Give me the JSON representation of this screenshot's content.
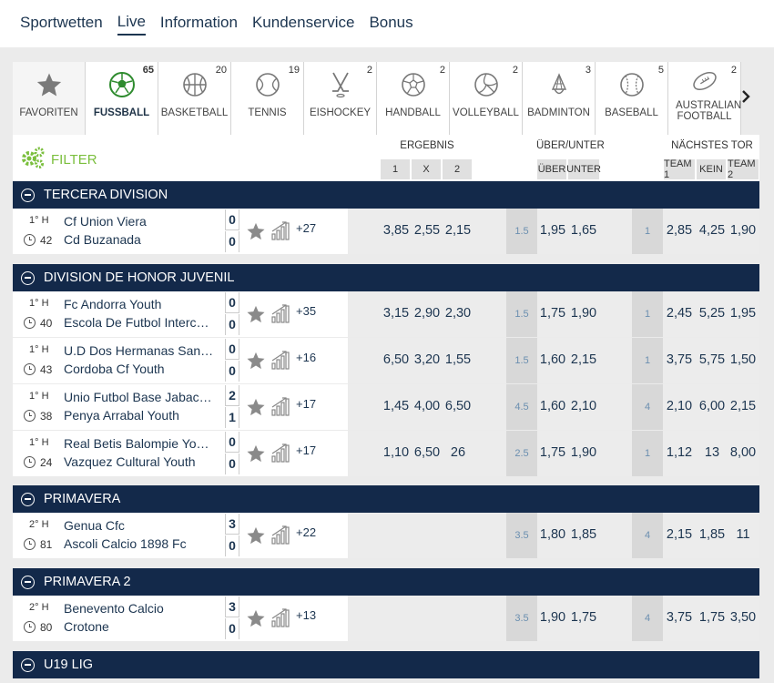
{
  "nav": {
    "items": [
      {
        "label": "Sportwetten",
        "active": false
      },
      {
        "label": "Live",
        "active": true
      },
      {
        "label": "Information",
        "active": false
      },
      {
        "label": "Kundenservice",
        "active": false
      },
      {
        "label": "Bonus",
        "active": false
      }
    ]
  },
  "sports": [
    {
      "label": "FAVORITEN",
      "count": "",
      "icon": "star-icon"
    },
    {
      "label": "FUSSBALL",
      "count": "65",
      "icon": "soccer-ball-icon",
      "active": true
    },
    {
      "label": "BASKETBALL",
      "count": "20",
      "icon": "basketball-icon"
    },
    {
      "label": "TENNIS",
      "count": "19",
      "icon": "tennis-ball-icon"
    },
    {
      "label": "EISHOCKEY",
      "count": "2",
      "icon": "hockey-sticks-icon"
    },
    {
      "label": "HANDBALL",
      "count": "2",
      "icon": "handball-icon"
    },
    {
      "label": "VOLLEYBALL",
      "count": "2",
      "icon": "volleyball-icon"
    },
    {
      "label": "BADMINTON",
      "count": "3",
      "icon": "shuttlecock-icon"
    },
    {
      "label": "BASEBALL",
      "count": "5",
      "icon": "baseball-icon"
    },
    {
      "label": "AUSTRALIAN FOOTBALL",
      "count": "2",
      "icon": "rugby-ball-icon"
    }
  ],
  "header": {
    "filter_label": "FILTER",
    "ergebnis": "ERGEBNIS",
    "ergebnis_cols": [
      "1",
      "X",
      "2"
    ],
    "ueber_unter": "ÜBER/UNTER",
    "ueber_unter_cols": [
      "ÜBER",
      "UNTER"
    ],
    "naechstes_tor": "NÄCHSTES TOR",
    "naechstes_tor_cols": [
      "TEAM 1",
      "KEIN",
      "TEAM 2"
    ]
  },
  "groups": [
    {
      "name": "TERCERA DIVISION",
      "matches": [
        {
          "period": "1° H",
          "minute": "42",
          "home": "Cf Union Viera",
          "away": "Cd Buzanada",
          "score_home": "0",
          "score_away": "0",
          "more": "+27",
          "odds_1": "3,85",
          "odds_x": "2,55",
          "odds_2": "2,15",
          "ou_line": "1.5",
          "over": "1,95",
          "under": "1,65",
          "ng_line": "1",
          "ng_team1": "2,85",
          "ng_none": "4,25",
          "ng_team2": "1,90"
        }
      ]
    },
    {
      "name": "DIVISION DE HONOR JUVENIL",
      "matches": [
        {
          "period": "1° H",
          "minute": "40",
          "home": "Fc Andorra Youth",
          "away": "Escola De Futbol Interc…",
          "score_home": "0",
          "score_away": "0",
          "more": "+35",
          "odds_1": "3,15",
          "odds_x": "2,90",
          "odds_2": "2,30",
          "ou_line": "1.5",
          "over": "1,75",
          "under": "1,90",
          "ng_line": "1",
          "ng_team1": "2,45",
          "ng_none": "5,25",
          "ng_team2": "1,95"
        },
        {
          "period": "1° H",
          "minute": "43",
          "home": "U.D Dos Hermanas San…",
          "away": "Cordoba Cf Youth",
          "score_home": "0",
          "score_away": "0",
          "more": "+16",
          "odds_1": "6,50",
          "odds_x": "3,20",
          "odds_2": "1,55",
          "ou_line": "1.5",
          "over": "1,60",
          "under": "2,15",
          "ng_line": "1",
          "ng_team1": "3,75",
          "ng_none": "5,75",
          "ng_team2": "1,50"
        },
        {
          "period": "1° H",
          "minute": "38",
          "home": "Unio Futbol Base Jabac…",
          "away": "Penya Arrabal Youth",
          "score_home": "2",
          "score_away": "1",
          "more": "+17",
          "odds_1": "1,45",
          "odds_x": "4,00",
          "odds_2": "6,50",
          "ou_line": "4.5",
          "over": "1,60",
          "under": "2,10",
          "ng_line": "4",
          "ng_team1": "2,10",
          "ng_none": "6,00",
          "ng_team2": "2,15"
        },
        {
          "period": "1° H",
          "minute": "24",
          "home": "Real Betis Balompie Yo…",
          "away": "Vazquez Cultural Youth",
          "score_home": "0",
          "score_away": "0",
          "more": "+17",
          "odds_1": "1,10",
          "odds_x": "6,50",
          "odds_2": "26",
          "ou_line": "2.5",
          "over": "1,75",
          "under": "1,90",
          "ng_line": "1",
          "ng_team1": "1,12",
          "ng_none": "13",
          "ng_team2": "8,00"
        }
      ]
    },
    {
      "name": "PRIMAVERA",
      "matches": [
        {
          "period": "2° H",
          "minute": "81",
          "home": "Genua Cfc",
          "away": "Ascoli Calcio 1898 Fc",
          "score_home": "3",
          "score_away": "0",
          "more": "+22",
          "odds_1": "",
          "odds_x": "",
          "odds_2": "",
          "ou_line": "3.5",
          "over": "1,80",
          "under": "1,85",
          "ng_line": "4",
          "ng_team1": "2,15",
          "ng_none": "1,85",
          "ng_team2": "11"
        }
      ]
    },
    {
      "name": "PRIMAVERA 2",
      "matches": [
        {
          "period": "2° H",
          "minute": "80",
          "home": "Benevento Calcio",
          "away": "Crotone",
          "score_home": "3",
          "score_away": "0",
          "more": "+13",
          "odds_1": "",
          "odds_x": "",
          "odds_2": "",
          "ou_line": "3.5",
          "over": "1,90",
          "under": "1,75",
          "ng_line": "4",
          "ng_team1": "3,75",
          "ng_none": "1,75",
          "ng_team2": "3,50"
        }
      ]
    },
    {
      "name": "U19 LIG",
      "matches": []
    }
  ],
  "colors": {
    "navy": "#13294a",
    "filter_green": "#7bbf3e",
    "line_blue": "#6b8fb0"
  }
}
